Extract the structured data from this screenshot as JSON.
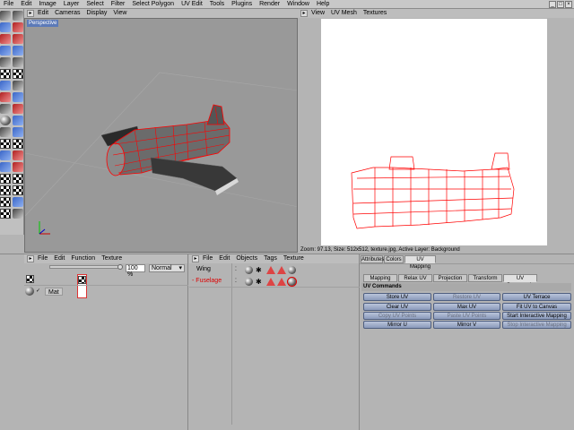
{
  "menubar": {
    "items": [
      "File",
      "Edit",
      "Image",
      "Layer",
      "Select",
      "Filter",
      "Select Polygon",
      "UV Edit",
      "Tools",
      "Plugins",
      "Render",
      "Window",
      "Help"
    ]
  },
  "viewport": {
    "menu": [
      "Edit",
      "Cameras",
      "Display",
      "View"
    ],
    "label": "Perspective",
    "axis_y": "y",
    "axis_x": "x"
  },
  "uv_view": {
    "menu": [
      "View",
      "UV Mesh",
      "Textures"
    ],
    "status": "Zoom: 97.13, Size: 512x512, texture.jpg, Active Layer: Background"
  },
  "material_manager": {
    "menu": [
      "File",
      "Edit",
      "Function",
      "Texture"
    ],
    "percent": "100 %",
    "mode": "Normal",
    "material_name": "Mat"
  },
  "object_manager": {
    "menu": [
      "File",
      "Edit",
      "Objects",
      "Tags",
      "Texture"
    ],
    "objects": [
      {
        "name": "Wing"
      },
      {
        "name": "Fuselage"
      }
    ]
  },
  "attributes": {
    "top_tabs": [
      "Attributes",
      "Colors",
      "UV Mapping"
    ],
    "sub_tabs": [
      "Mapping",
      "Relax UV",
      "Projection",
      "Transform",
      "UV Commands"
    ],
    "section": "UV Commands",
    "buttons": [
      [
        "Store UV",
        "Restore UV",
        "UV Terrace"
      ],
      [
        "Clear UV",
        "Max UV",
        "Fit UV to Canvas"
      ],
      [
        "Copy UV Points",
        "Paste UV Points",
        "Start Interactive Mapping"
      ],
      [
        "Mirror U",
        "Mirror V",
        "Stop Interactive Mapping"
      ]
    ],
    "disabled": [
      "Restore UV",
      "Copy UV Points",
      "Paste UV Points",
      "Stop Interactive Mapping"
    ]
  },
  "colors": {
    "wire": "#ff0000",
    "viewport_bg": "#999999",
    "button": "#9aa8c6"
  }
}
